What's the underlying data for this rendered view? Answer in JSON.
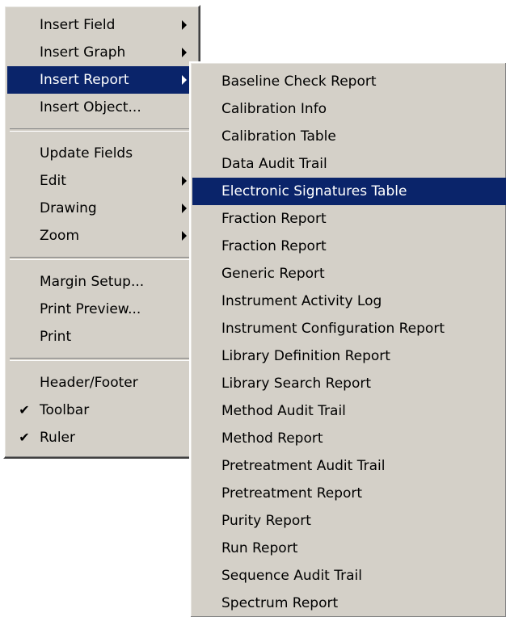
{
  "main_menu": {
    "groups": [
      {
        "items": [
          {
            "label": "Insert Field",
            "submenu": true
          },
          {
            "label": "Insert Graph",
            "submenu": true
          },
          {
            "label": "Insert Report",
            "submenu": true,
            "highlighted": true
          },
          {
            "label": "Insert Object...",
            "submenu": false
          }
        ]
      },
      {
        "items": [
          {
            "label": "Update Fields",
            "submenu": false
          },
          {
            "label": "Edit",
            "submenu": true
          },
          {
            "label": "Drawing",
            "submenu": true
          },
          {
            "label": "Zoom",
            "submenu": true
          }
        ]
      },
      {
        "items": [
          {
            "label": "Margin Setup...",
            "submenu": false
          },
          {
            "label": "Print Preview...",
            "submenu": false
          },
          {
            "label": "Print",
            "submenu": false
          }
        ]
      },
      {
        "items": [
          {
            "label": "Header/Footer",
            "submenu": false
          },
          {
            "label": "Toolbar",
            "checked": true
          },
          {
            "label": "Ruler",
            "checked": true
          }
        ]
      }
    ]
  },
  "check_glyph": "✔",
  "submenu": {
    "items": [
      "Baseline Check Report",
      "Calibration Info",
      "Calibration Table",
      "Data Audit Trail",
      "Electronic Signatures Table",
      "Fraction Report",
      "Fraction Report",
      "Generic Report",
      "Instrument Activity Log",
      "Instrument Configuration Report",
      "Library Definition Report",
      "Library Search Report",
      "Method Audit Trail",
      "Method Report",
      "Pretreatment Audit Trail",
      "Pretreatment Report",
      "Purity Report",
      "Run Report",
      "Sequence Audit Trail",
      "Spectrum Report"
    ],
    "highlighted": "Electronic Signatures Table"
  },
  "colors": {
    "menu_face": "#d4d0c8",
    "highlight_bg": "#0a246a",
    "highlight_text": "#ffffff"
  }
}
